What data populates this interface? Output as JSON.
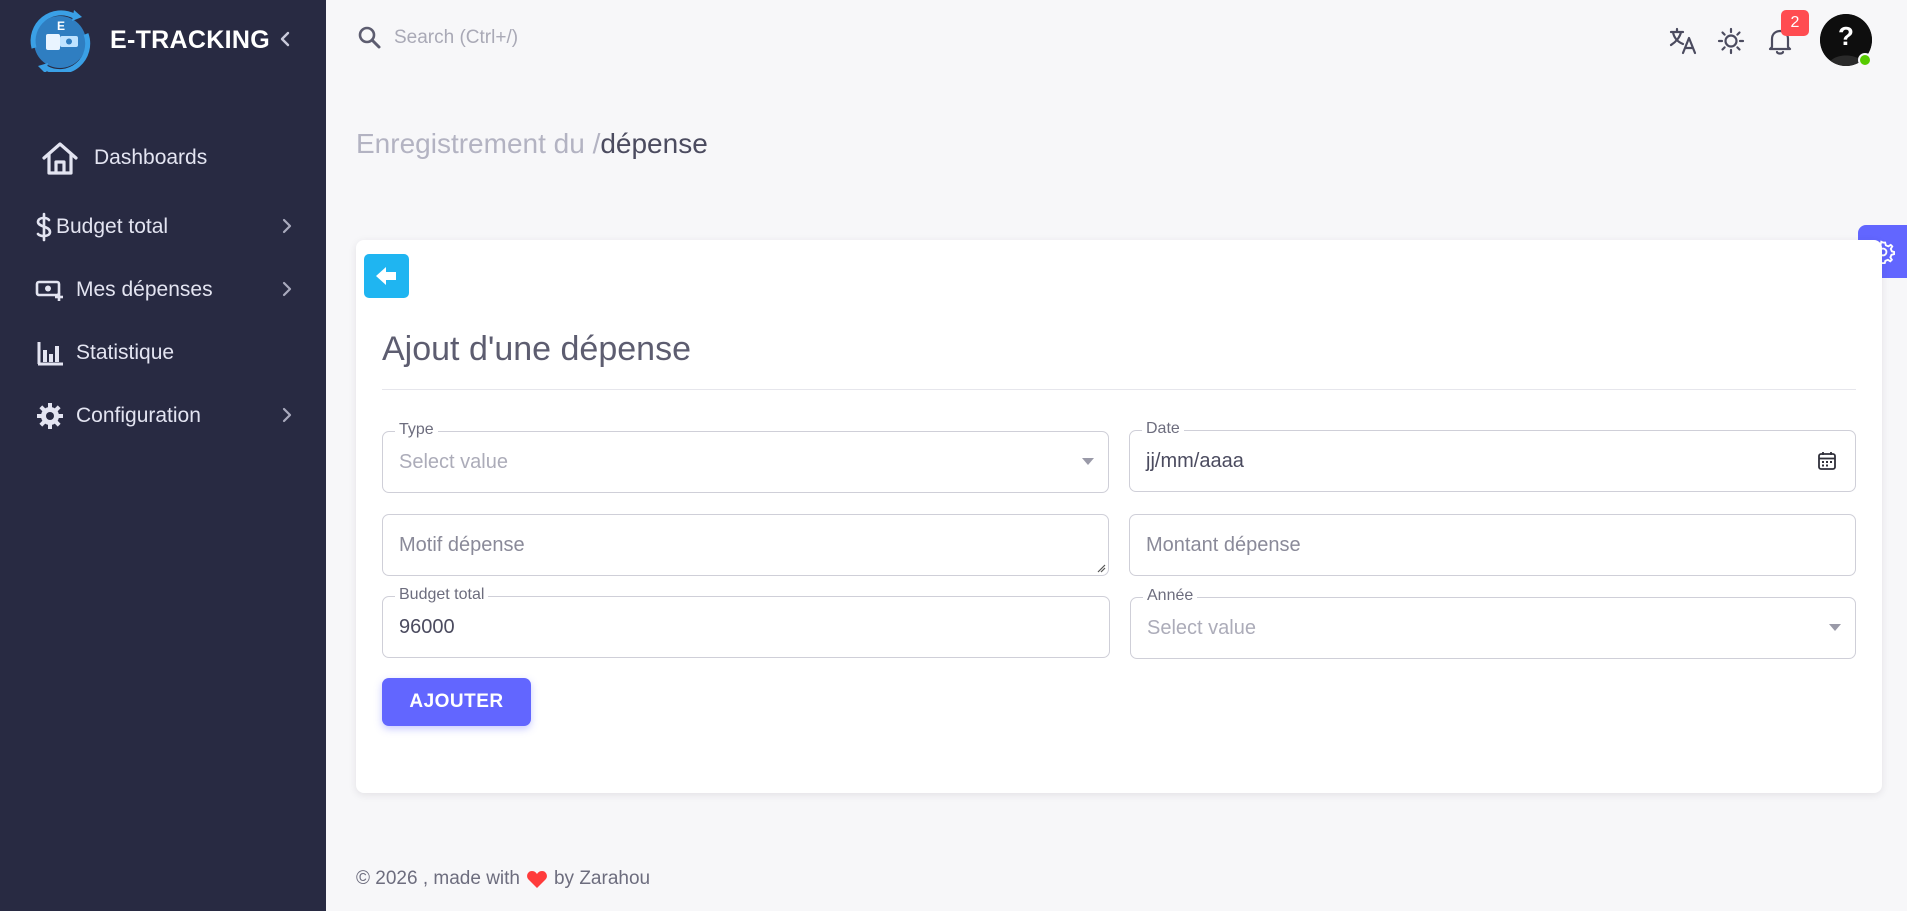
{
  "brand": {
    "name": "E-TRACKING",
    "logo_letter": "E"
  },
  "sidebar": {
    "items": [
      {
        "label": "Dashboards",
        "icon": "home-icon",
        "has_submenu": false
      },
      {
        "label": "Budget total",
        "icon": "dollar-icon",
        "has_submenu": true
      },
      {
        "label": "Mes dépenses",
        "icon": "cash-plus-icon",
        "has_submenu": true
      },
      {
        "label": "Statistique",
        "icon": "bar-chart-icon",
        "has_submenu": false
      },
      {
        "label": "Configuration",
        "icon": "gear-icon",
        "has_submenu": true
      }
    ]
  },
  "topbar": {
    "search_placeholder": "Search (Ctrl+/)",
    "notification_count": "2",
    "avatar_glyph": "?"
  },
  "breadcrumb": {
    "prefix": "Enregistrement du /",
    "current": "dépense"
  },
  "form": {
    "title": "Ajout d'une dépense",
    "type": {
      "label": "Type",
      "placeholder": "Select value"
    },
    "date": {
      "label": "Date",
      "value": "jj/mm/aaaa"
    },
    "motif": {
      "placeholder": "Motif dépense"
    },
    "montant": {
      "placeholder": "Montant dépense"
    },
    "budget_total": {
      "label": "Budget total",
      "value": "96000"
    },
    "annee": {
      "label": "Année",
      "placeholder": "Select value"
    },
    "submit_label": "AJOUTER"
  },
  "footer": {
    "prefix": "© 2026 , made with",
    "suffix": "by Zarahou"
  },
  "colors": {
    "sidebar_bg": "#282a42",
    "primary": "#6266ff",
    "back_button": "#1fb5f1",
    "badge": "#ff4c51",
    "online": "#56ca00",
    "heart": "#ff3b3b"
  }
}
